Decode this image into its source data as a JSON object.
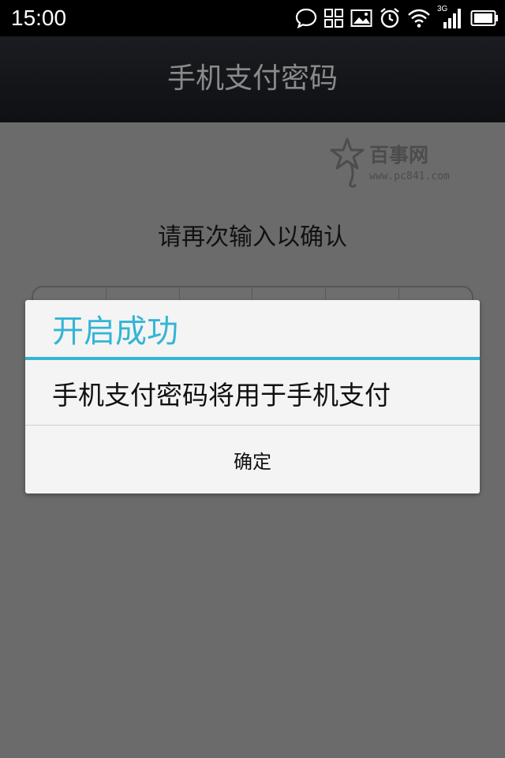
{
  "status_bar": {
    "time": "15:00",
    "network_label": "3G",
    "icons": [
      "chat-bubble-icon",
      "grid-icon",
      "image-icon",
      "alarm-clock-icon",
      "wifi-icon",
      "signal-3g-icon",
      "battery-icon"
    ]
  },
  "header": {
    "title": "手机支付密码"
  },
  "watermark": {
    "name": "百事网",
    "url": "www.pc841.com"
  },
  "main": {
    "prompt": "请再次输入以确认",
    "pin_length": 6
  },
  "dialog": {
    "title": "开启成功",
    "message": "手机支付密码将用于手机支付",
    "confirm_label": "确定"
  },
  "colors": {
    "accent": "#33b5d5",
    "status_bar": "#000000",
    "title_bar": "#15171a",
    "overlay_background": "#6b6b6b",
    "dialog_background": "#f4f4f4"
  }
}
